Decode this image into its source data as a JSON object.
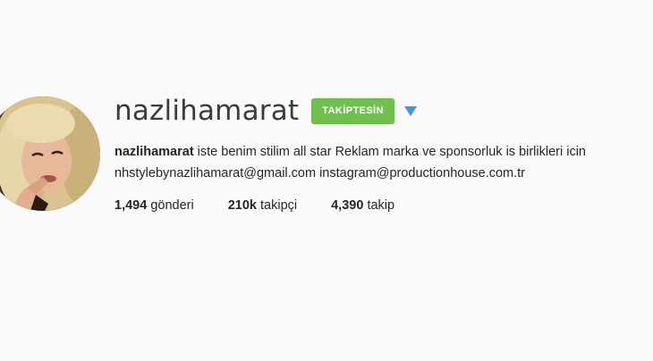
{
  "profile": {
    "username": "nazlihamarat",
    "follow_button_label": "TAKİPTESİN",
    "dropdown_icon": "caret-down-icon",
    "accent_color": "#70c050",
    "dropdown_color": "#3897f0",
    "bio": {
      "name": "nazlihamarat",
      "text": " iste benim stilim all star Reklam marka ve sponsorluk is birlikleri icin",
      "contact": "nhstylebynazlihamarat@gmail.com instagram@productionhouse.com.tr"
    },
    "stats": {
      "posts_count": "1,494",
      "posts_label": "gönderi",
      "followers_count": "210k",
      "followers_label": "takipçi",
      "following_count": "4,390",
      "following_label": "takip"
    }
  }
}
